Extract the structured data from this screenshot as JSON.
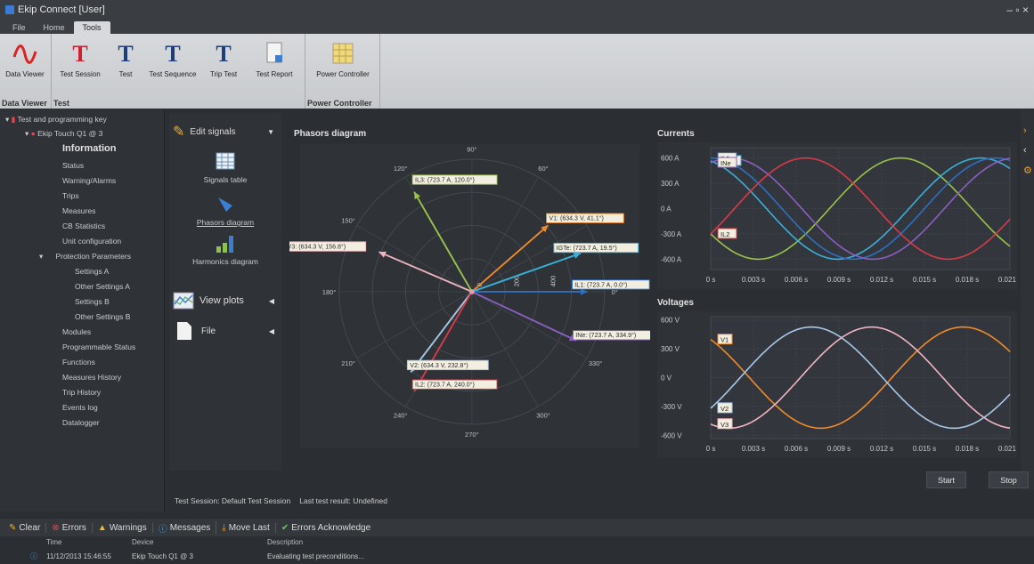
{
  "window": {
    "title": "Ekip Connect [User]",
    "controls": "– ▫ ×"
  },
  "menu": {
    "tabs": [
      "File",
      "Home",
      "Tools"
    ],
    "active": "Tools"
  },
  "ribbon": {
    "groups": [
      {
        "label": "Data Viewer",
        "buttons": [
          "Data Viewer"
        ]
      },
      {
        "label": "Test",
        "buttons": [
          "Test Session",
          "Test",
          "Test Sequence",
          "Trip Test",
          "Test Report"
        ]
      },
      {
        "label": "Power Controller",
        "buttons": [
          "Power Controller"
        ]
      }
    ]
  },
  "tree": {
    "root": "Test and programming key",
    "device": "Ekip Touch Q1 @ 3",
    "items": [
      "Information",
      "Status",
      "Warning/Alarms",
      "Trips",
      "Measures",
      "CB Statistics",
      "Unit configuration",
      "Protection Parameters",
      "Settings A",
      "Other Settings A",
      "Settings B",
      "Other Settings B",
      "Modules",
      "Programmable Status",
      "Functions",
      "Measures History",
      "Trip History",
      "Events log",
      "Datalogger"
    ]
  },
  "nav": {
    "edit_signals": "Edit signals",
    "signals_table": "Signals table",
    "phasors_diagram": "Phasors diagram",
    "harmonics_diagram": "Harmonics diagram",
    "view_plots": "View plots",
    "file": "File"
  },
  "phasor": {
    "title": "Phasors diagram",
    "angle_labels": [
      "90°",
      "60°",
      "30°",
      "0°",
      "330°",
      "300°",
      "270°",
      "240°",
      "210°",
      "180°",
      "150°",
      "120°"
    ],
    "radial_labels": [
      "0",
      "200",
      "400"
    ],
    "vectors": [
      {
        "label": "IL3: (723.7 A, 120.0°)",
        "angle": 120,
        "mag": 723.7,
        "color": "#9bc24a"
      },
      {
        "label": "V1: (634.3 V, 41.1°)",
        "angle": 41.1,
        "mag": 634.3,
        "color": "#f08a2a"
      },
      {
        "label": "IGTe: (723.7 A, 19.5°)",
        "angle": 19.5,
        "mag": 723.7,
        "color": "#3ab0d8"
      },
      {
        "label": "IL1: (723.7 A, 0.0°)",
        "angle": 0,
        "mag": 723.7,
        "color": "#2f6fbf"
      },
      {
        "label": "V3: (634.3 V, 156.8°)",
        "angle": 156.8,
        "mag": 634.3,
        "color": "#f2b4c0"
      },
      {
        "label": "INe: (723.7 A, 334.9°)",
        "angle": 334.9,
        "mag": 723.7,
        "color": "#8a5fc0"
      },
      {
        "label": "V2: (634.3 V, 232.8°)",
        "angle": 232.8,
        "mag": 634.3,
        "color": "#a8c8e8"
      },
      {
        "label": "IL2: (723.7 A, 240.0°)",
        "angle": 240,
        "mag": 723.7,
        "color": "#d83a4a"
      }
    ]
  },
  "chart_data": [
    {
      "type": "line",
      "title": "Currents",
      "ylabel": "",
      "y_ticks": [
        "600 A",
        "300 A",
        "0 A",
        "-300 A",
        "-600 A"
      ],
      "x_ticks": [
        "0 s",
        "0.003 s",
        "0.006 s",
        "0.009 s",
        "0.012 s",
        "0.015 s",
        "0.018 s",
        "0.021 s"
      ],
      "ylim": [
        -723.7,
        723.7
      ],
      "xlim": [
        0,
        0.021
      ],
      "series": [
        {
          "name": "IL3",
          "amplitude": 723.7,
          "phase_deg": 120,
          "color": "#9bc24a"
        },
        {
          "name": "IGTe",
          "amplitude": 723.7,
          "phase_deg": 19.5,
          "color": "#3ab0d8"
        },
        {
          "name": "IL1",
          "amplitude": 723.7,
          "phase_deg": 0,
          "color": "#2f6fbf"
        },
        {
          "name": "INe",
          "amplitude": 723.7,
          "phase_deg": 334.9,
          "color": "#8a5fc0"
        },
        {
          "name": "IL2",
          "amplitude": 723.7,
          "phase_deg": 240,
          "color": "#d83a4a"
        }
      ]
    },
    {
      "type": "line",
      "title": "Voltages",
      "y_ticks": [
        "600 V",
        "300 V",
        "0 V",
        "-300 V",
        "-600 V"
      ],
      "x_ticks": [
        "0 s",
        "0.003 s",
        "0.006 s",
        "0.009 s",
        "0.012 s",
        "0.015 s",
        "0.018 s",
        "0.021 s"
      ],
      "ylim": [
        -634.3,
        634.3
      ],
      "xlim": [
        0,
        0.021
      ],
      "series": [
        {
          "name": "V1",
          "amplitude": 634.3,
          "phase_deg": 41.1,
          "color": "#f08a2a"
        },
        {
          "name": "V3",
          "amplitude": 634.3,
          "phase_deg": 156.8,
          "color": "#f2b4c0"
        },
        {
          "name": "V2",
          "amplitude": 634.3,
          "phase_deg": 232.8,
          "color": "#a8c8e8"
        }
      ]
    }
  ],
  "buttons": {
    "start": "Start",
    "stop": "Stop"
  },
  "status": {
    "session": "Test Session: Default Test Session",
    "result": "Last test result: Undefined"
  },
  "log": {
    "toolbar": [
      "Clear",
      "Errors",
      "Warnings",
      "Messages",
      "Move Last",
      "Errors Acknowledge"
    ],
    "headers": [
      "Time",
      "Device",
      "Description"
    ],
    "rows": [
      {
        "time": "11/12/2013 15:46:55",
        "device": "Ekip Touch Q1 @ 3",
        "description": "Evaluating test preconditions..."
      }
    ]
  }
}
